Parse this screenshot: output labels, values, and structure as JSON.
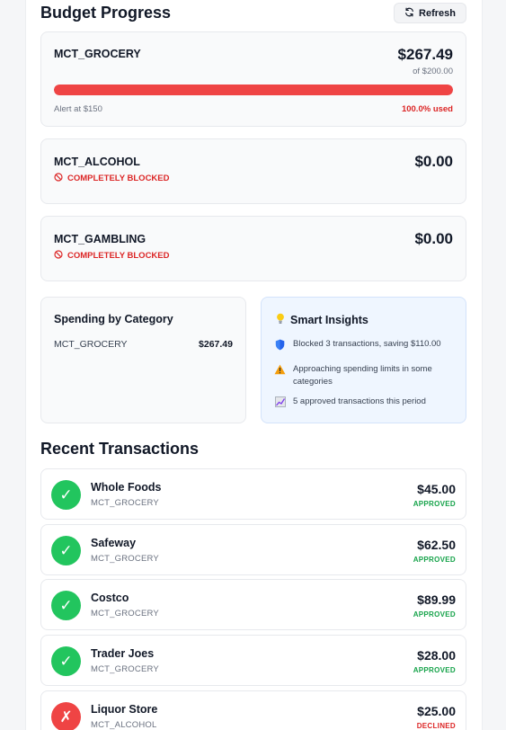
{
  "budget": {
    "title": "Budget Progress",
    "refresh_label": "Refresh",
    "items": [
      {
        "category": "MCT_GROCERY",
        "amount": "$267.49",
        "limit_text": "of $200.00",
        "alert_text": "Alert at $150",
        "used_text": "100.0% used",
        "progress_percent": 100
      },
      {
        "category": "MCT_ALCOHOL",
        "amount": "$0.00",
        "status": "COMPLETELY BLOCKED"
      },
      {
        "category": "MCT_GAMBLING",
        "amount": "$0.00",
        "status": "COMPLETELY BLOCKED"
      }
    ]
  },
  "spending": {
    "title": "Spending by Category",
    "rows": [
      {
        "category": "MCT_GROCERY",
        "amount": "$267.49"
      }
    ]
  },
  "insights": {
    "title": "Smart Insights",
    "items": [
      {
        "icon": "shield-icon",
        "text": "Blocked 3 transactions, saving $110.00"
      },
      {
        "icon": "warning-icon",
        "text": "Approaching spending limits in some categories"
      },
      {
        "icon": "chart-icon",
        "text": "5 approved transactions this period"
      }
    ]
  },
  "transactions": {
    "title": "Recent Transactions",
    "items": [
      {
        "merchant": "Whole Foods",
        "category": "MCT_GROCERY",
        "amount": "$45.00",
        "status": "APPROVED"
      },
      {
        "merchant": "Safeway",
        "category": "MCT_GROCERY",
        "amount": "$62.50",
        "status": "APPROVED"
      },
      {
        "merchant": "Costco",
        "category": "MCT_GROCERY",
        "amount": "$89.99",
        "status": "APPROVED"
      },
      {
        "merchant": "Trader Joes",
        "category": "MCT_GROCERY",
        "amount": "$28.00",
        "status": "APPROVED"
      },
      {
        "merchant": "Liquor Store",
        "category": "MCT_ALCOHOL",
        "amount": "$25.00",
        "status": "DECLINED"
      }
    ]
  },
  "colors": {
    "approved": "#16a34a",
    "approved_icon": "#22c55e",
    "declined": "#dc2626",
    "declined_icon": "#ef4444",
    "progress_fill": "#ef4444",
    "insights_bg": "#eff6ff"
  }
}
